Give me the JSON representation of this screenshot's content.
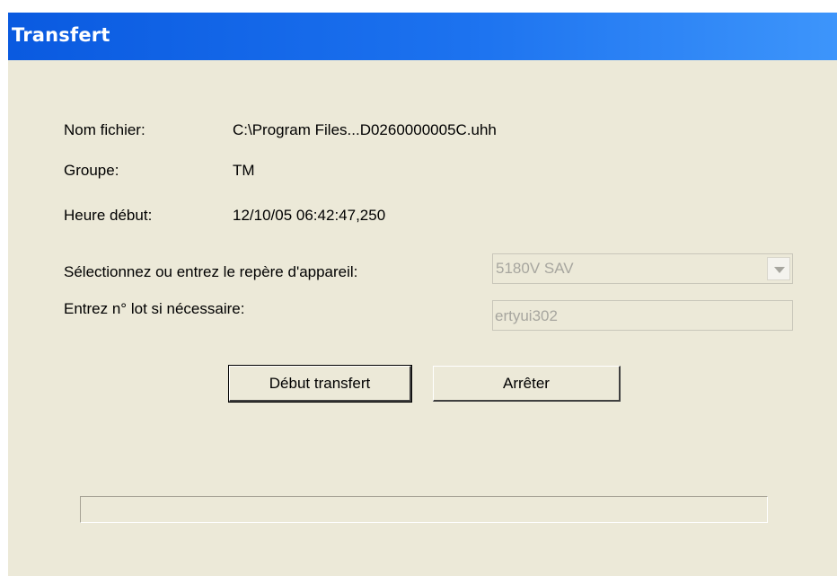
{
  "window": {
    "title": "Transfert"
  },
  "info": {
    "file_label": "Nom fichier:",
    "file_value": "C:\\Program Files...D0260000005C.uhh",
    "group_label": "Groupe:",
    "group_value": "TM",
    "start_label": "Heure début:",
    "start_value": "12/10/05 06:42:47,250"
  },
  "device": {
    "label": "Sélectionnez ou entrez le repère d'appareil:",
    "selected": "5180V SAV",
    "enabled": false
  },
  "lot": {
    "label": "Entrez n° lot si nécessaire:",
    "value": "ertyui302",
    "enabled": false
  },
  "buttons": {
    "start_label": "Début transfert",
    "stop_label": "Arrêter"
  },
  "progress": {
    "value": 0
  },
  "colors": {
    "title_bar": "#0a5ae0",
    "dialog_bg": "#ece9d8",
    "disabled_text": "#a7a69f"
  },
  "icons": {
    "combo_arrow": "chevron-down-icon"
  }
}
